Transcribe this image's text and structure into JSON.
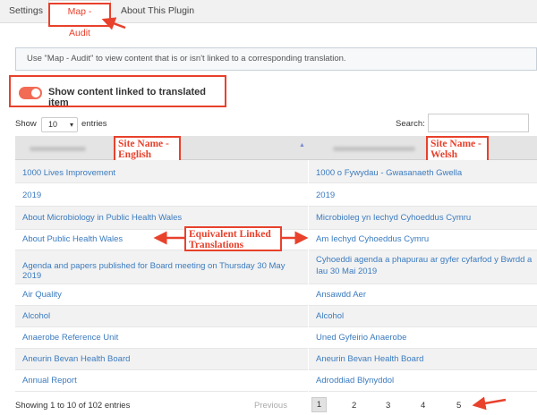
{
  "tabs": [
    {
      "label": "Settings"
    },
    {
      "label": "Map - Audit"
    },
    {
      "label": "About This Plugin"
    }
  ],
  "info": "Use \"Map - Audit\" to view content that is or isn't linked to a corresponding translation.",
  "toggle": {
    "label": "Show content linked to translated item",
    "on": true
  },
  "length": {
    "show": "Show",
    "value": "10",
    "entries": "entries"
  },
  "search": {
    "label": "Search:",
    "value": ""
  },
  "annotations": {
    "english": "Site Name -\nEnglish",
    "welsh": "Site Name -\nWelsh",
    "linked": "Equivalent Linked\nTranslations"
  },
  "rows": [
    {
      "en": "1000 Lives Improvement",
      "cy": "1000 o Fywydau - Gwasanaeth Gwella"
    },
    {
      "en": "2019",
      "cy": "2019"
    },
    {
      "en": "About Microbiology in Public Health Wales",
      "cy": "Microbioleg yn Iechyd Cyhoeddus Cymru"
    },
    {
      "en": "About Public Health Wales",
      "cy": "Am Iechyd Cyhoeddus Cymru"
    },
    {
      "en": "Agenda and papers published for Board meeting on Thursday 30 May 2019",
      "cy": "Cyhoeddi agenda a phapurau ar gyfer cyfarfod y Bwrdd a Iau 30 Mai 2019"
    },
    {
      "en": "Air Quality",
      "cy": "Ansawdd Aer"
    },
    {
      "en": "Alcohol",
      "cy": "Alcohol"
    },
    {
      "en": "Anaerobe Reference Unit",
      "cy": "Uned Gyfeirio Anaerobe"
    },
    {
      "en": "Aneurin Bevan Health Board",
      "cy": "Aneurin Bevan Health Board"
    },
    {
      "en": "Annual Report",
      "cy": "Adroddiad Blynyddol"
    }
  ],
  "footer": {
    "info": "Showing 1 to 10 of 102 entries"
  },
  "pagination": {
    "previous": "Previous",
    "pages": [
      "1",
      "2",
      "3",
      "4",
      "5"
    ]
  },
  "colors": {
    "accent": "#e8412c",
    "link": "#3b7bbf"
  }
}
